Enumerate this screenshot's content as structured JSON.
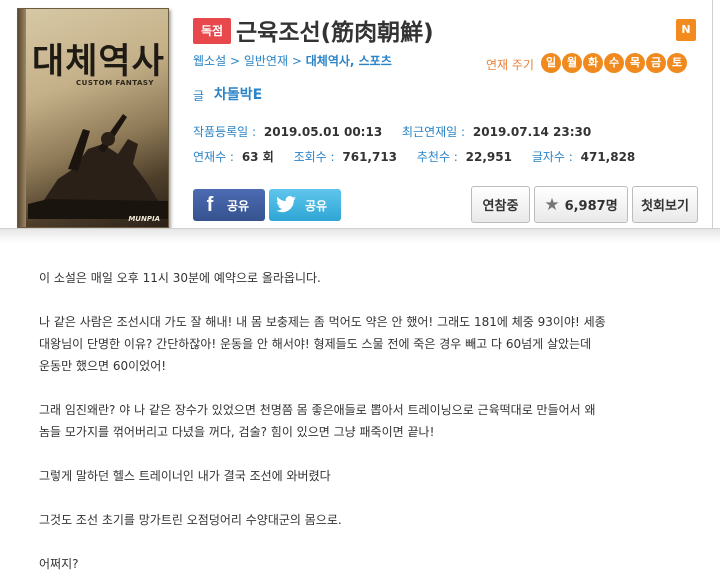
{
  "cover": {
    "title": "대체역사",
    "subtitle": "CUSTOM FANTASY",
    "logo": "MUNPIA"
  },
  "header": {
    "badge": "독점",
    "title": "근육조선(筋肉朝鮮)",
    "n_badge": "N",
    "breadcrumb_1": "웹소설",
    "breadcrumb_2": "일반연재",
    "breadcrumb_3": "대체역사, 스포츠",
    "separator": ">",
    "cycle_label": "연재 주기",
    "cycle_days": [
      "일",
      "월",
      "화",
      "수",
      "목",
      "금",
      "토"
    ],
    "author_label": "글",
    "author_name": "차돌박E"
  },
  "stats": {
    "registered_label": "작품등록일 :",
    "registered_value": "2019.05.01 00:13",
    "latest_label": "최근연재일 :",
    "latest_value": "2019.07.14 23:30",
    "episodes_label": "연재수 :",
    "episodes_value": "63 회",
    "views_label": "조회수 :",
    "views_value": "761,713",
    "recommend_label": "추천수 :",
    "recommend_value": "22,951",
    "chars_label": "글자수 :",
    "chars_value": "471,828"
  },
  "buttons": {
    "facebook_share": "공유",
    "twitter_share": "공유",
    "reference": "연참중",
    "recommend_count": "6,987명",
    "first_episode": "첫회보기"
  },
  "content": {
    "p1": "이 소설은 매일 오후 11시 30분에 예약으로 올라옵니다.",
    "p2_l1": "나 같은 사람은 조선시대 가도 잘 해내! 내 몸 보충제는 좀 먹어도 약은 안 했어! 그래도 181에 체중 93이야! 세종",
    "p2_l2": "대왕님이 단명한 이유? 간단하잖아! 운동을 안 해서야! 형제들도 스물 전에 죽은 경우 빼고 다 60넘게 살았는데",
    "p2_l3": "운동만 했으면 60이었어!",
    "p3_l1": "그래 임진왜란? 야 나 같은 장수가 있었으면 천명쯤 몸 좋은애들로 뽑아서 트레이닝으로 근육떡대로 만들어서 왜",
    "p3_l2": "놈들 모가지를 꺾어버리고 다녔을 꺼다, 검술? 힘이 있으면 그냥 패죽이면 끝나!",
    "p4": "그렇게 말하던 헬스 트레이너인 내가 결국 조선에 와버렸다",
    "p5": "그것도 조선 초기를 망가트린 오점덩어리 수양대군의 몸으로.",
    "p6": "어쩌지?"
  }
}
